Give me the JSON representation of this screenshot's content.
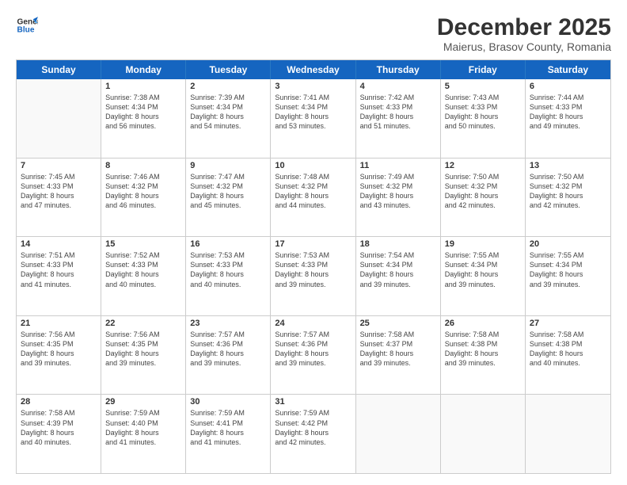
{
  "header": {
    "logo_line1": "General",
    "logo_line2": "Blue",
    "title": "December 2025",
    "subtitle": "Maierus, Brasov County, Romania"
  },
  "days_of_week": [
    "Sunday",
    "Monday",
    "Tuesday",
    "Wednesday",
    "Thursday",
    "Friday",
    "Saturday"
  ],
  "weeks": [
    [
      {
        "day": "",
        "empty": true
      },
      {
        "day": "1",
        "sunrise": "7:38 AM",
        "sunset": "4:34 PM",
        "daylight": "8 hours and 56 minutes."
      },
      {
        "day": "2",
        "sunrise": "7:39 AM",
        "sunset": "4:34 PM",
        "daylight": "8 hours and 54 minutes."
      },
      {
        "day": "3",
        "sunrise": "7:41 AM",
        "sunset": "4:34 PM",
        "daylight": "8 hours and 53 minutes."
      },
      {
        "day": "4",
        "sunrise": "7:42 AM",
        "sunset": "4:33 PM",
        "daylight": "8 hours and 51 minutes."
      },
      {
        "day": "5",
        "sunrise": "7:43 AM",
        "sunset": "4:33 PM",
        "daylight": "8 hours and 50 minutes."
      },
      {
        "day": "6",
        "sunrise": "7:44 AM",
        "sunset": "4:33 PM",
        "daylight": "8 hours and 49 minutes."
      }
    ],
    [
      {
        "day": "7",
        "sunrise": "7:45 AM",
        "sunset": "4:33 PM",
        "daylight": "8 hours and 47 minutes."
      },
      {
        "day": "8",
        "sunrise": "7:46 AM",
        "sunset": "4:32 PM",
        "daylight": "8 hours and 46 minutes."
      },
      {
        "day": "9",
        "sunrise": "7:47 AM",
        "sunset": "4:32 PM",
        "daylight": "8 hours and 45 minutes."
      },
      {
        "day": "10",
        "sunrise": "7:48 AM",
        "sunset": "4:32 PM",
        "daylight": "8 hours and 44 minutes."
      },
      {
        "day": "11",
        "sunrise": "7:49 AM",
        "sunset": "4:32 PM",
        "daylight": "8 hours and 43 minutes."
      },
      {
        "day": "12",
        "sunrise": "7:50 AM",
        "sunset": "4:32 PM",
        "daylight": "8 hours and 42 minutes."
      },
      {
        "day": "13",
        "sunrise": "7:50 AM",
        "sunset": "4:32 PM",
        "daylight": "8 hours and 42 minutes."
      }
    ],
    [
      {
        "day": "14",
        "sunrise": "7:51 AM",
        "sunset": "4:33 PM",
        "daylight": "8 hours and 41 minutes."
      },
      {
        "day": "15",
        "sunrise": "7:52 AM",
        "sunset": "4:33 PM",
        "daylight": "8 hours and 40 minutes."
      },
      {
        "day": "16",
        "sunrise": "7:53 AM",
        "sunset": "4:33 PM",
        "daylight": "8 hours and 40 minutes."
      },
      {
        "day": "17",
        "sunrise": "7:53 AM",
        "sunset": "4:33 PM",
        "daylight": "8 hours and 39 minutes."
      },
      {
        "day": "18",
        "sunrise": "7:54 AM",
        "sunset": "4:34 PM",
        "daylight": "8 hours and 39 minutes."
      },
      {
        "day": "19",
        "sunrise": "7:55 AM",
        "sunset": "4:34 PM",
        "daylight": "8 hours and 39 minutes."
      },
      {
        "day": "20",
        "sunrise": "7:55 AM",
        "sunset": "4:34 PM",
        "daylight": "8 hours and 39 minutes."
      }
    ],
    [
      {
        "day": "21",
        "sunrise": "7:56 AM",
        "sunset": "4:35 PM",
        "daylight": "8 hours and 39 minutes."
      },
      {
        "day": "22",
        "sunrise": "7:56 AM",
        "sunset": "4:35 PM",
        "daylight": "8 hours and 39 minutes."
      },
      {
        "day": "23",
        "sunrise": "7:57 AM",
        "sunset": "4:36 PM",
        "daylight": "8 hours and 39 minutes."
      },
      {
        "day": "24",
        "sunrise": "7:57 AM",
        "sunset": "4:36 PM",
        "daylight": "8 hours and 39 minutes."
      },
      {
        "day": "25",
        "sunrise": "7:58 AM",
        "sunset": "4:37 PM",
        "daylight": "8 hours and 39 minutes."
      },
      {
        "day": "26",
        "sunrise": "7:58 AM",
        "sunset": "4:38 PM",
        "daylight": "8 hours and 39 minutes."
      },
      {
        "day": "27",
        "sunrise": "7:58 AM",
        "sunset": "4:38 PM",
        "daylight": "8 hours and 40 minutes."
      }
    ],
    [
      {
        "day": "28",
        "sunrise": "7:58 AM",
        "sunset": "4:39 PM",
        "daylight": "8 hours and 40 minutes."
      },
      {
        "day": "29",
        "sunrise": "7:59 AM",
        "sunset": "4:40 PM",
        "daylight": "8 hours and 41 minutes."
      },
      {
        "day": "30",
        "sunrise": "7:59 AM",
        "sunset": "4:41 PM",
        "daylight": "8 hours and 41 minutes."
      },
      {
        "day": "31",
        "sunrise": "7:59 AM",
        "sunset": "4:42 PM",
        "daylight": "8 hours and 42 minutes."
      },
      {
        "day": "",
        "empty": true
      },
      {
        "day": "",
        "empty": true
      },
      {
        "day": "",
        "empty": true
      }
    ]
  ],
  "labels": {
    "sunrise_prefix": "Sunrise: ",
    "sunset_prefix": "Sunset: ",
    "daylight_prefix": "Daylight: "
  }
}
